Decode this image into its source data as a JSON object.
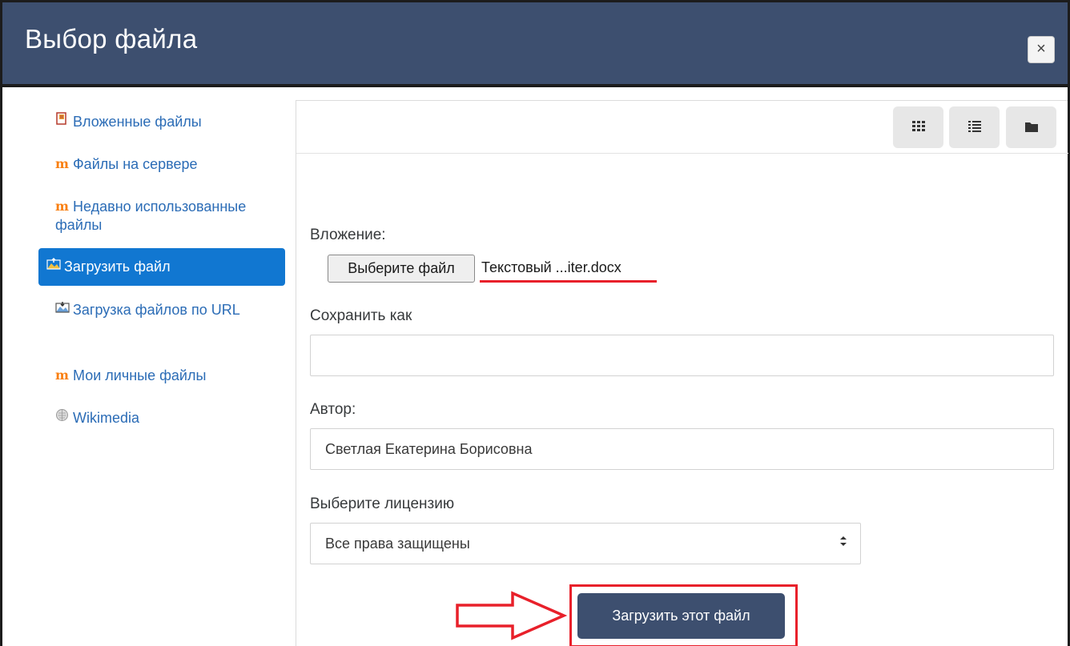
{
  "dialog": {
    "title": "Выбор файла",
    "close_label": "×"
  },
  "sidebar": {
    "items": [
      {
        "label": "Вложенные файлы",
        "icon": "attachment-icon"
      },
      {
        "label": "Файлы на сервере",
        "icon": "moodle-icon"
      },
      {
        "label": "Недавно использованные файлы",
        "icon": "moodle-icon"
      },
      {
        "label": "Загрузить файл",
        "icon": "upload-icon",
        "active": true
      },
      {
        "label": "Загрузка файлов по URL",
        "icon": "url-download-icon"
      },
      {
        "label": "Мои личные файлы",
        "icon": "moodle-icon"
      },
      {
        "label": "Wikimedia",
        "icon": "wikimedia-icon"
      }
    ]
  },
  "toolbar": {
    "views": [
      "grid-view-icon",
      "list-view-icon",
      "folder-view-icon"
    ]
  },
  "form": {
    "attachment_label": "Вложение:",
    "choose_file_label": "Выберите файл",
    "file_name": "Текстовый ...iter.docx",
    "save_as_label": "Сохранить как",
    "save_as_value": "",
    "author_label": "Автор:",
    "author_value": "Светлая Екатерина Борисовна",
    "license_label": "Выберите лицензию",
    "license_value": "Все права защищены",
    "submit_label": "Загрузить этот файл"
  },
  "colors": {
    "header": "#3d4f6f",
    "active_item": "#1177d1",
    "link": "#2b6cb6",
    "highlight": "#e8202a"
  }
}
